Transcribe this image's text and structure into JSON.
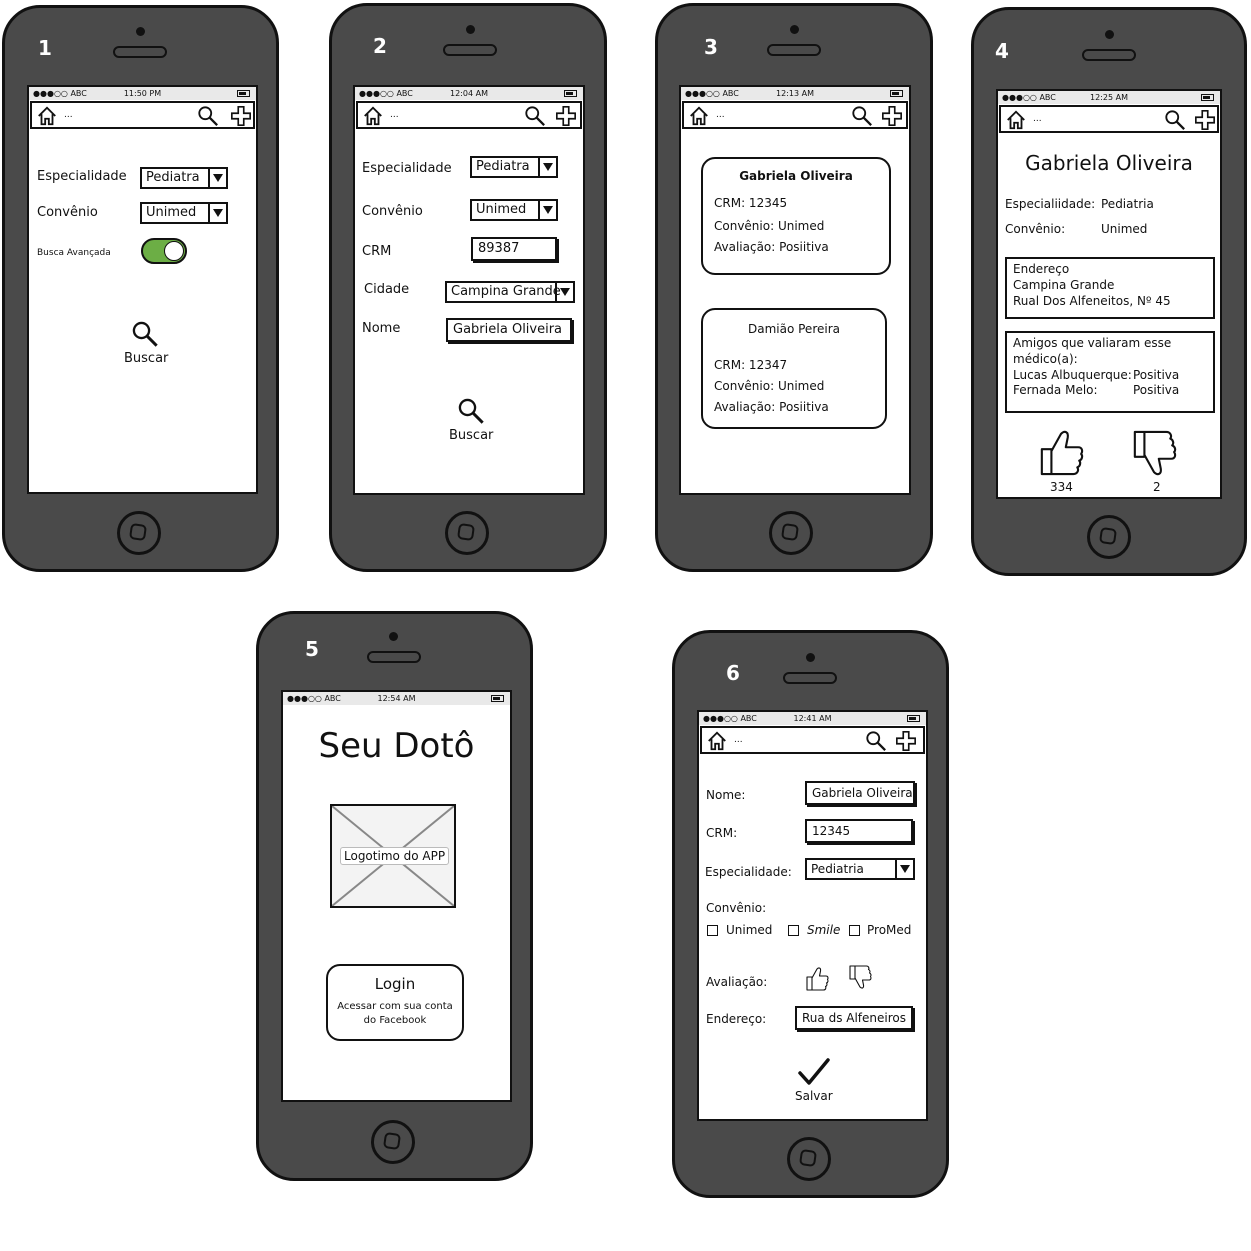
{
  "status_bar": {
    "carrier": "●●●○○ ABC",
    "battery": "battery-icon"
  },
  "navbar": {
    "dots": "..."
  },
  "phones": [
    {
      "number": "1",
      "time": "11:50 PM",
      "especialidade_label": "Especialidade",
      "especialidade_value": "Pediatra",
      "convenio_label": "Convênio",
      "convenio_value": "Unimed",
      "busca_label": "Busca Avançada",
      "busca_toggle": "on",
      "buscar_label": "Buscar"
    },
    {
      "number": "2",
      "time": "12:04 AM",
      "especialidade_label": "Especialidade",
      "especialidade_value": "Pediatra",
      "convenio_label": "Convênio",
      "convenio_value": "Unimed",
      "crm_label": "CRM",
      "crm_value": "89387",
      "cidade_label": "Cidade",
      "cidade_value": "Campina Grande",
      "nome_label": "Nome",
      "nome_value": "Gabriela Oliveira",
      "buscar_label": "Buscar"
    },
    {
      "number": "3",
      "time": "12:13 AM",
      "results": [
        {
          "name": "Gabriela Oliveira",
          "crm": "CRM: 12345",
          "convenio": "Convênio: Unimed",
          "avaliacao": "Avaliação: Posiitiva"
        },
        {
          "name": "Damião Pereira",
          "crm": "CRM: 12347",
          "convenio": "Convênio: Unimed",
          "avaliacao": "Avaliação: Posiitiva"
        }
      ]
    },
    {
      "number": "4",
      "time": "12:25 AM",
      "name": "Gabriela Oliveira",
      "especialidade_label": "Especialiidade:",
      "especialidade_value": "Pediatria",
      "convenio_label": "Convênio:",
      "convenio_value": "Unimed",
      "endereco_lines": [
        "Endereço",
        "Campina Grande",
        "Rual Dos Alfeneitos, Nº 45"
      ],
      "amigos_lines": [
        "Amigos que valiaram esse",
        "médico(a):"
      ],
      "amigos": [
        {
          "name": "Lucas Albuquerque:",
          "rating": "Positiva"
        },
        {
          "name": "Fernada Melo:",
          "rating": "Positiva"
        }
      ],
      "likes": "334",
      "dislikes": "2"
    },
    {
      "number": "5",
      "time": "12:54 AM",
      "title": "Seu Dotô",
      "logo_label": "Logotimo do APP",
      "login_title": "Login",
      "login_sub_1": "Acessar com sua conta",
      "login_sub_2": "do Facebook"
    },
    {
      "number": "6",
      "time": "12:41 AM",
      "nome_label": "Nome:",
      "nome_value": "Gabriela Oliveira",
      "crm_label": "CRM:",
      "crm_value": "12345",
      "especialidade_label": "Especialidade:",
      "especialidade_value": "Pediatria",
      "convenio_label": "Convênio:",
      "convenio_options": [
        "Unimed",
        "Smile",
        "ProMed"
      ],
      "avaliacao_label": "Avaliação:",
      "endereco_label": "Endereço:",
      "endereco_value": "Rua ds Alfeneiros",
      "salvar_label": "Salvar"
    }
  ]
}
